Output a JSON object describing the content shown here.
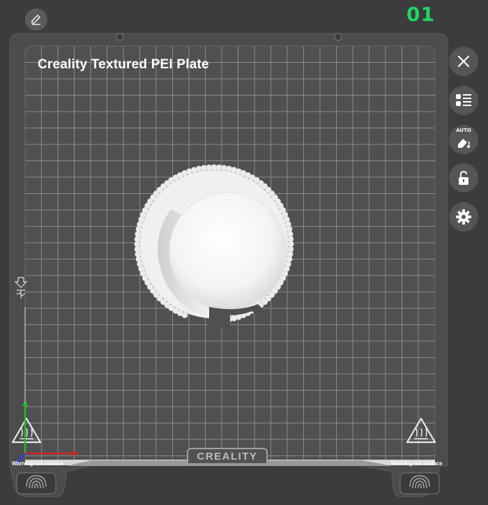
{
  "header": {
    "plate_number": "01"
  },
  "bed": {
    "plate_title": "Creality Textured PEI Plate",
    "brand": "CREALITY",
    "warning_left": "Warning hot surface",
    "warning_right": "Warning hot surface"
  },
  "toolbar": {
    "items": [
      {
        "name": "close",
        "icon": "close-icon"
      },
      {
        "name": "object-list",
        "icon": "list-icon"
      },
      {
        "name": "auto-arrange",
        "icon": "auto-arrange-icon",
        "label": "AUTO"
      },
      {
        "name": "lock",
        "icon": "unlock-icon"
      },
      {
        "name": "settings",
        "icon": "gear-icon"
      }
    ]
  },
  "colors": {
    "background": "#3c3c3e",
    "plate": "#4f4f51",
    "grid": "#8a8a8c",
    "accent_green": "#1ed760",
    "axis_red": "#e02020",
    "axis_green": "#20c020",
    "axis_blue": "#2040ff"
  }
}
